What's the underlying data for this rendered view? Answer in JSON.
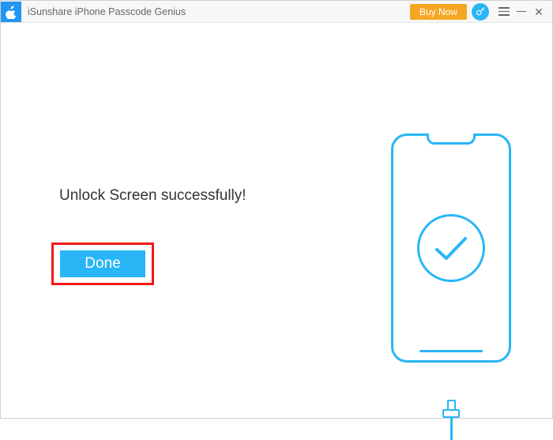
{
  "titlebar": {
    "app_name": "iSunshare iPhone Passcode Genius",
    "buy_now_label": "Buy Now"
  },
  "main": {
    "message": "Unlock Screen successfully!",
    "done_label": "Done"
  }
}
